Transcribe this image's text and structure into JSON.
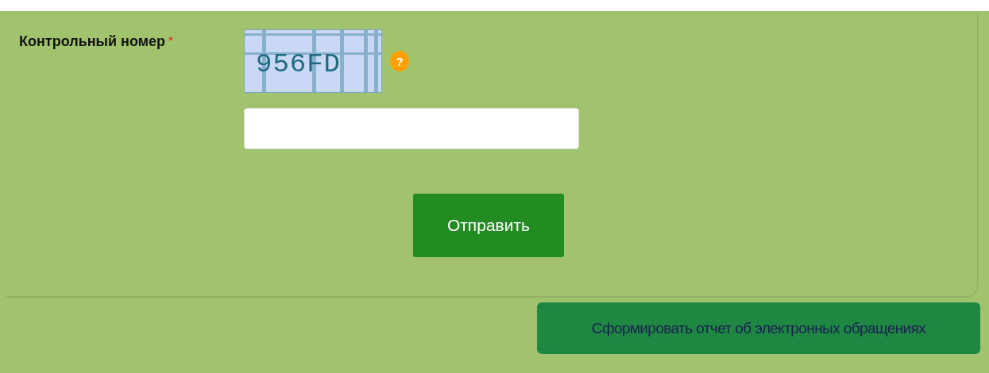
{
  "form": {
    "captcha_label": "Контрольный номер",
    "required_mark": "*",
    "captcha_code": "956FD",
    "help_mark": "?",
    "submit_button": "Отправить"
  },
  "report_button": "Сформировать отчет об электронных обращениях"
}
